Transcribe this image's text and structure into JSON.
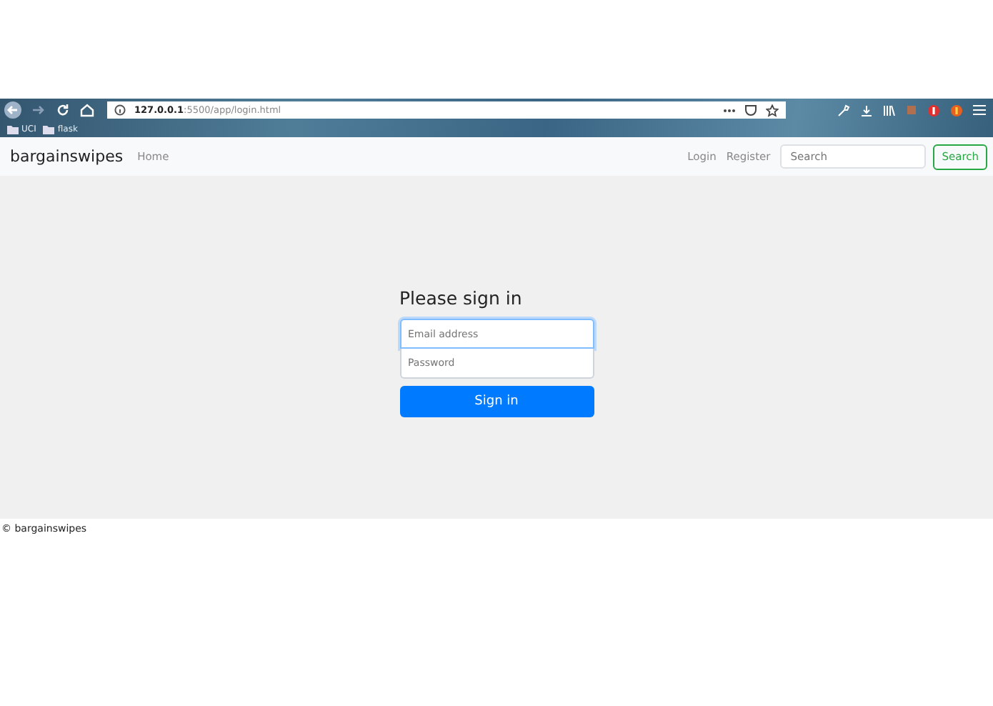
{
  "browser": {
    "url_host": "127.0.0.1",
    "url_path": ":5500/app/login.html",
    "bookmarks": [
      "UCI",
      "flask"
    ]
  },
  "navbar": {
    "brand": "bargainswipes",
    "left_links": [
      "Home"
    ],
    "right_links": [
      "Login",
      "Register"
    ],
    "search": {
      "placeholder": "Search"
    },
    "search_button": "Search"
  },
  "form": {
    "heading": "Please sign in",
    "email": {
      "placeholder": "Email address",
      "focused": true
    },
    "password": {
      "placeholder": "Password"
    },
    "submit": "Sign in"
  },
  "footer": "© bargainswipes"
}
